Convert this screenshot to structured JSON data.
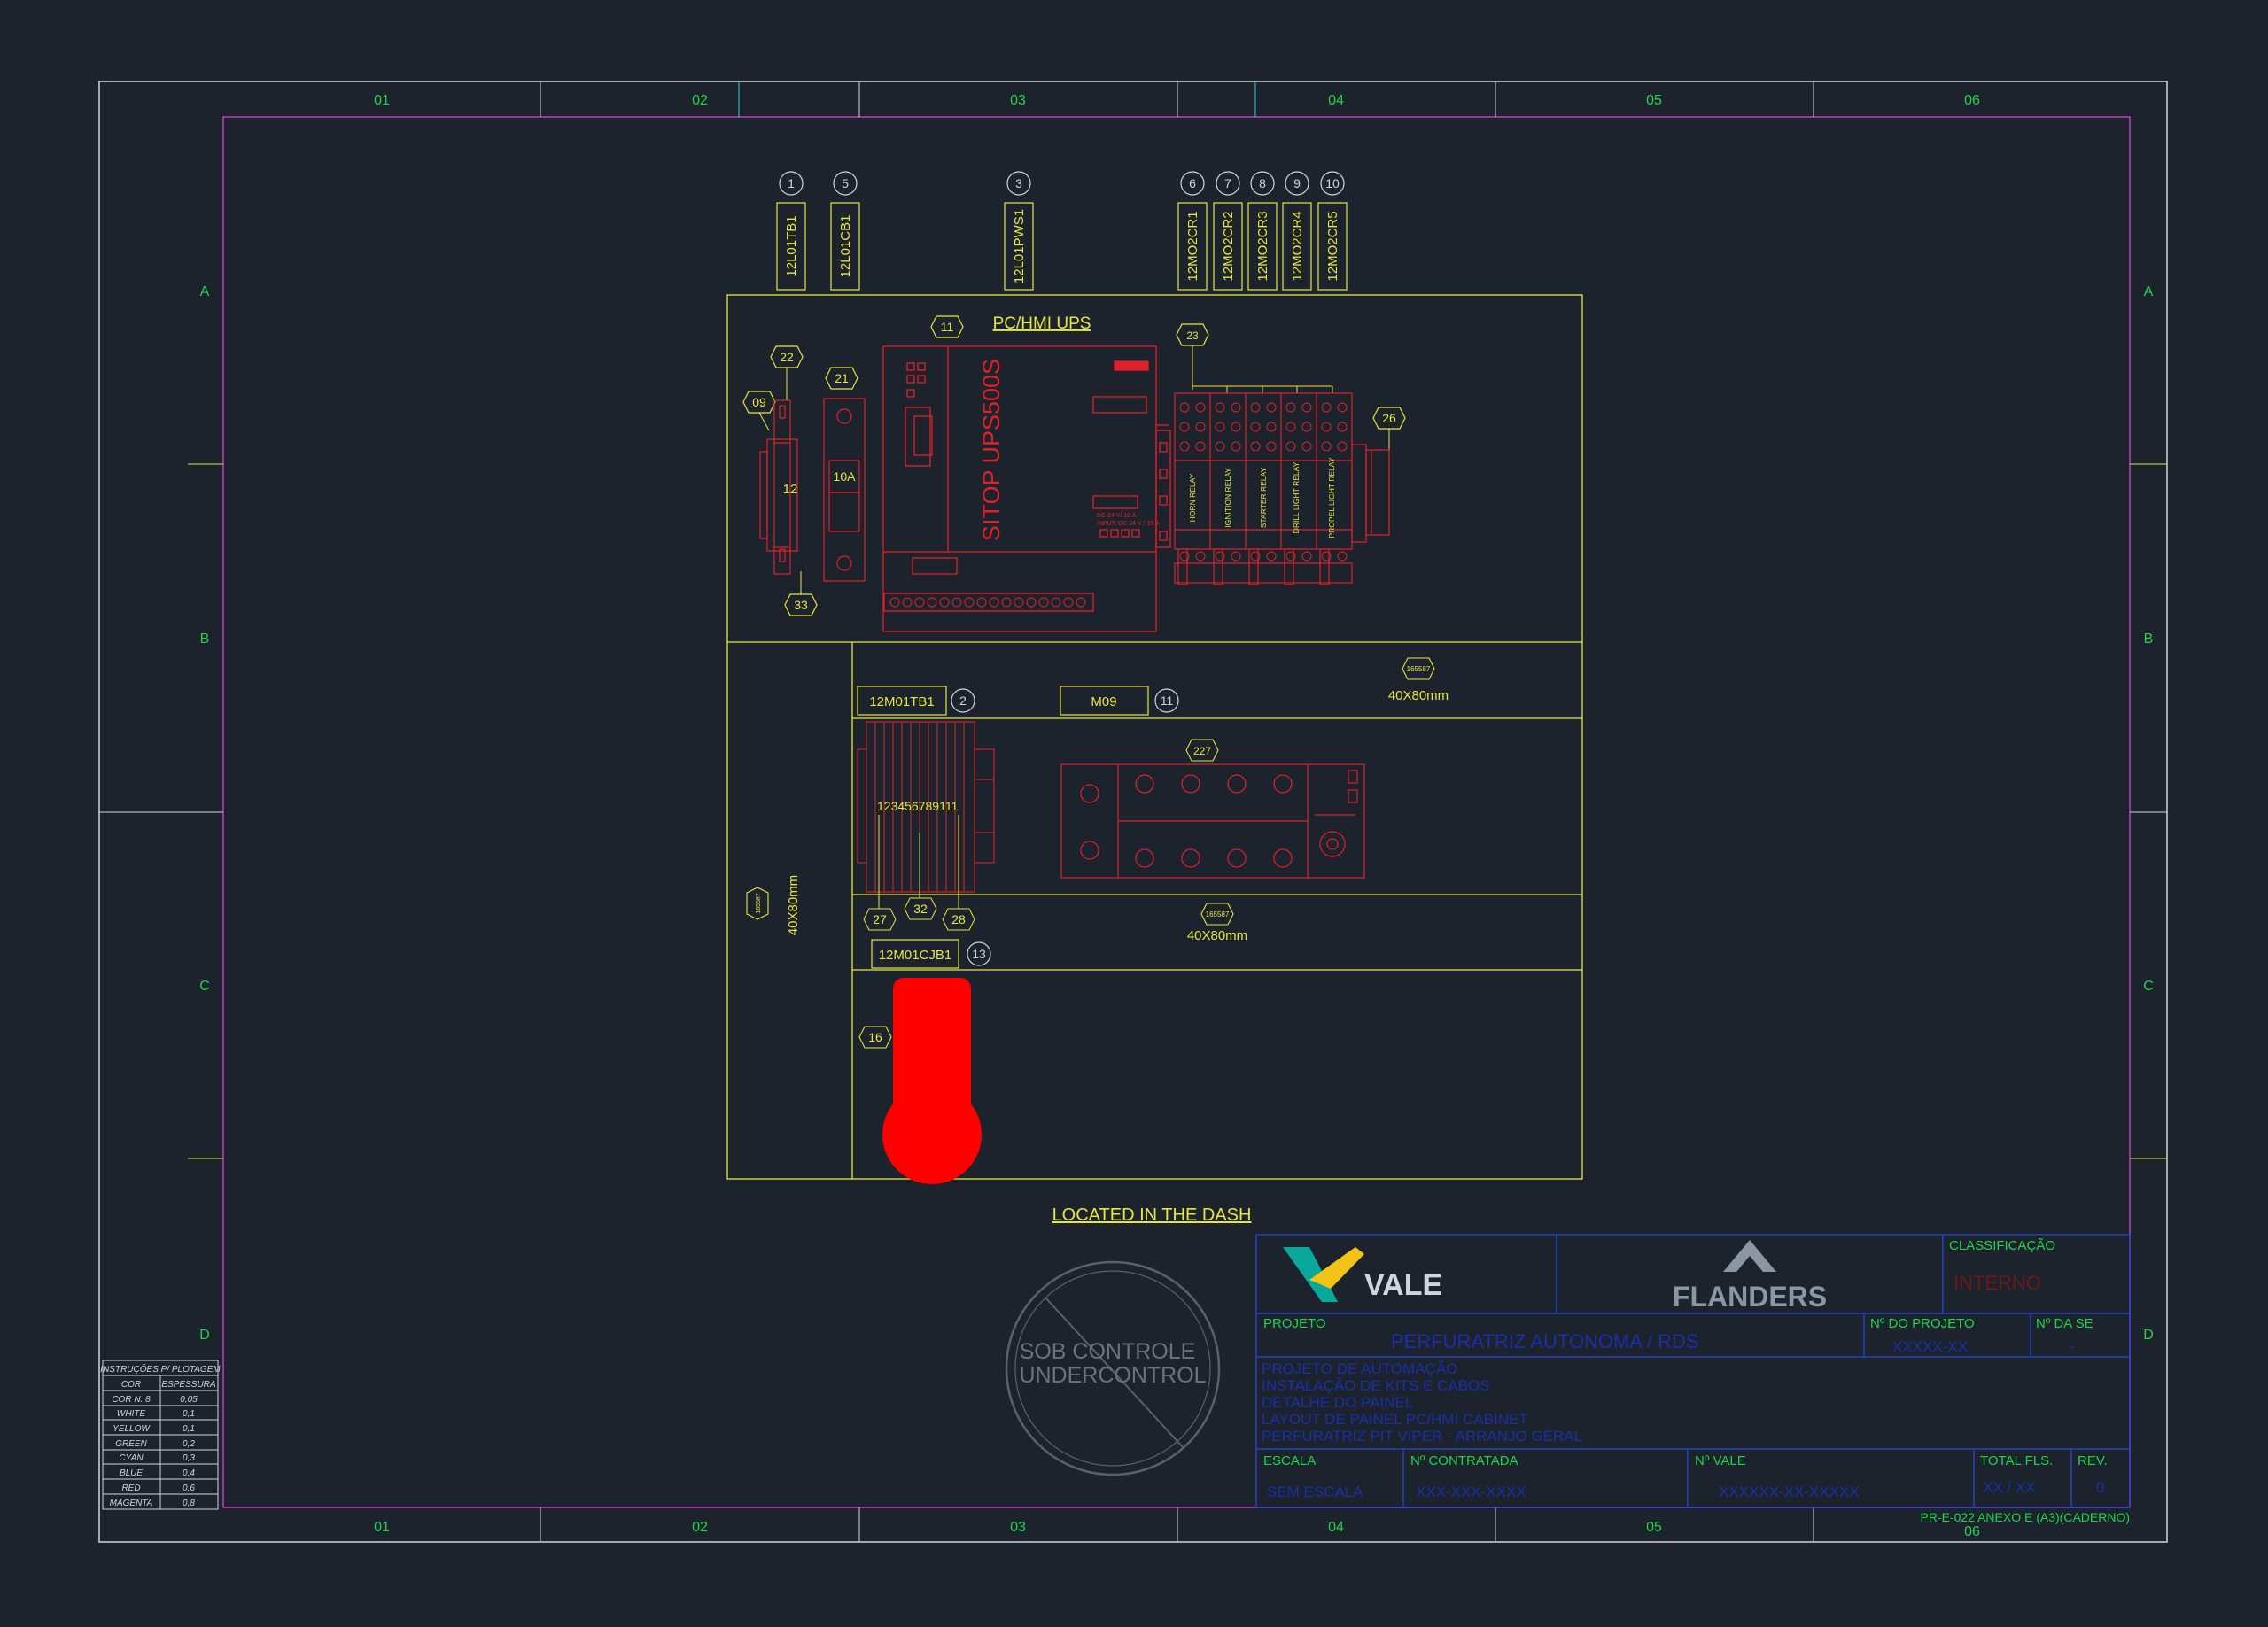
{
  "grid": {
    "columns": [
      "01",
      "02",
      "03",
      "04",
      "05",
      "06"
    ],
    "rows": [
      "A",
      "B",
      "C",
      "D"
    ]
  },
  "top_tags": [
    {
      "num": "1",
      "label": "12L01TB1"
    },
    {
      "num": "5",
      "label": "12L01CB1"
    },
    {
      "num": "3",
      "label": "12L01PWS1"
    },
    {
      "num": "6",
      "label": "12MO2CR1"
    },
    {
      "num": "7",
      "label": "12MO2CR2"
    },
    {
      "num": "8",
      "label": "12MO2CR3"
    },
    {
      "num": "9",
      "label": "12MO2CR4"
    },
    {
      "num": "10",
      "label": "12MO2CR5"
    }
  ],
  "ups_section": {
    "title": "PC/HMI UPS",
    "ups_label": "SITOP UPS500S",
    "breaker_rating": "10A",
    "terminal_count": "12",
    "ups_small_text": [
      "DC 24 V/ 10 A",
      "INPUT: DC 24 V / 15 A"
    ],
    "relay_labels": [
      "HORN RELAY",
      "IGNITION RELAY",
      "STARTER RELAY",
      "DRILL LIGHT RELAY",
      "PROPEL LIGHT RELAY"
    ],
    "callouts": {
      "c11": "11",
      "c22": "22",
      "c09": "09",
      "c21": "21",
      "c33": "33",
      "c23": "23",
      "c26": "26"
    }
  },
  "mid_section": {
    "tb_label": "12M01TB1",
    "tb_num": "2",
    "m09_label": "M09",
    "m09_num": "11",
    "duct_tag": "165587",
    "duct_size": "40X80mm",
    "c227": "227",
    "terminal_digits": "123456789111",
    "c27": "27",
    "c32": "32",
    "c28": "28",
    "duct2_tag": "165587",
    "duct2_size": "40X80mm",
    "vert_duct_tag": "165587",
    "vert_duct_size": "40X80mm",
    "cjb_label": "12M01CJB1",
    "cjb_num": "13",
    "c16": "16"
  },
  "dash_label": "LOCATED IN THE DASH",
  "stamp": {
    "line1": "SOB CONTROLE",
    "line2": "UNDERCONTROL"
  },
  "plot_table": {
    "title": "INSTRUÇÕES P/ PLOTAGEM",
    "headers": [
      "COR",
      "ESPESSURA"
    ],
    "rows": [
      [
        "COR N. 8",
        "0,05"
      ],
      [
        "WHITE",
        "0,1"
      ],
      [
        "YELLOW",
        "0,1"
      ],
      [
        "GREEN",
        "0,2"
      ],
      [
        "CYAN",
        "0,3"
      ],
      [
        "BLUE",
        "0,4"
      ],
      [
        "RED",
        "0,6"
      ],
      [
        "MAGENTA",
        "0,8"
      ]
    ]
  },
  "title_block": {
    "vale_brand": "VALE",
    "flanders_brand": "FLANDERS",
    "classificacao_label": "CLASSIFICAÇÃO",
    "classificacao_value": "INTERNO",
    "projeto_label": "PROJETO",
    "projeto_value": "PERFURATRIZ AUTONOMA / RDS",
    "n_projeto_label": "Nº DO PROJETO",
    "n_projeto_value": "XXXXX-XX",
    "n_da_se_label": "Nº DA SE",
    "n_da_se_value": "-",
    "desc_lines": [
      "PROJETO DE AUTOMAÇÃO",
      "INSTALAÇÃO DE KITS E CABOS",
      "DETALHE DO PAINEL",
      "LAYOUT DE PAINEL PC/HMI CABINET",
      "PERFURATRIZ PIT VIPER - ARRANJO GERAL"
    ],
    "escala_label": "ESCALA",
    "escala_value": "SEM ESCALA",
    "contratada_label": "Nº CONTRATADA",
    "contratada_value": "XXX-XXX-XXXX",
    "vale_no_label": "Nº VALE",
    "vale_no_value": "XXXXXX-XX-XXXXX",
    "total_label": "TOTAL FLS.",
    "total_value": "XX / XX",
    "rev_label": "REV.",
    "rev_value": "0"
  },
  "form_ref": "PR-E-022 ANEXO E (A3)(CADERNO)"
}
